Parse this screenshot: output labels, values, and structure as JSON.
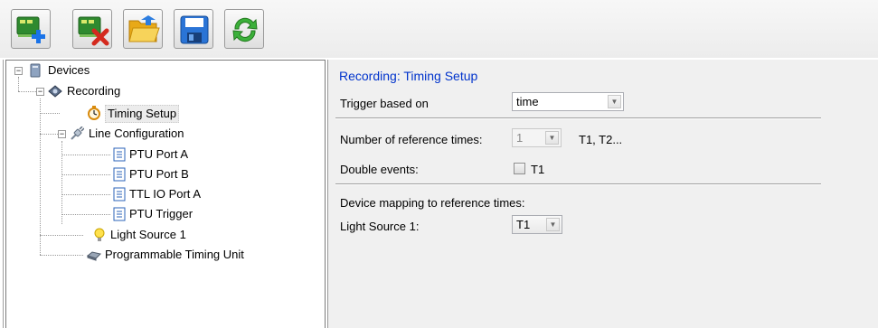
{
  "toolbar": {
    "buttons": [
      {
        "name": "add-device-button",
        "icon": "add-device-icon"
      },
      {
        "name": "remove-device-button",
        "icon": "remove-device-icon"
      },
      {
        "name": "open-button",
        "icon": "open-folder-icon"
      },
      {
        "name": "save-button",
        "icon": "save-floppy-icon"
      },
      {
        "name": "refresh-button",
        "icon": "refresh-icon"
      }
    ]
  },
  "tree": {
    "devices": "Devices",
    "recording": "Recording",
    "timing_setup": "Timing Setup",
    "line_configuration": "Line Configuration",
    "ptu_port_a": "PTU Port A",
    "ptu_port_b": "PTU Port B",
    "ttl_io_port_a": "TTL IO Port A",
    "ptu_trigger": "PTU Trigger",
    "light_source_1": "Light Source 1",
    "programmable_timing_unit": "Programmable Timing Unit"
  },
  "panel": {
    "title": "Recording: Timing Setup",
    "trigger_label": "Trigger based on",
    "trigger_value": "time",
    "num_ref_label": "Number of reference times:",
    "num_ref_value": "1",
    "num_ref_hint": "T1, T2...",
    "double_events_label": "Double events:",
    "double_events_checkbox_label": "T1",
    "double_events_checked": false,
    "mapping_heading": "Device mapping to reference times:",
    "light_source_label": "Light Source 1:",
    "light_source_value": "T1"
  },
  "colors": {
    "title_blue": "#0033cc",
    "panel_bg": "#f0f0f0",
    "selection_bg": "#ececec"
  }
}
